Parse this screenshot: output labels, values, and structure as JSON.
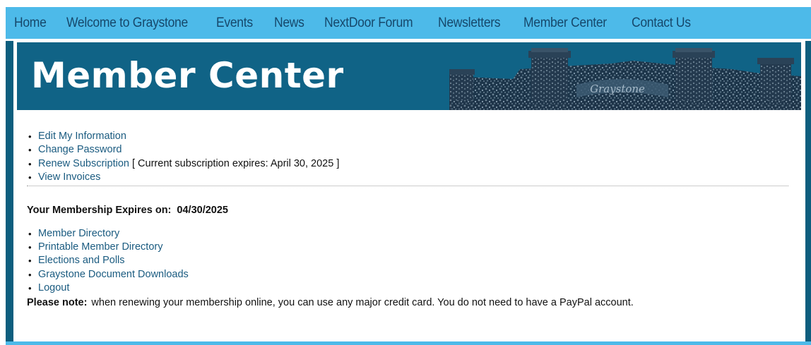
{
  "nav": {
    "items": [
      {
        "label": "Home"
      },
      {
        "label": "Welcome to Graystone"
      },
      {
        "label": "Events"
      },
      {
        "label": "News"
      },
      {
        "label": "NextDoor Forum"
      },
      {
        "label": "Newsletters"
      },
      {
        "label": "Member Center"
      },
      {
        "label": "Contact Us"
      }
    ]
  },
  "banner": {
    "title": "Member Center",
    "image": "graystone-stone-wall-entrance",
    "image_text": "Graystone"
  },
  "account_links": [
    {
      "label": "Edit My Information"
    },
    {
      "label": "Change Password"
    },
    {
      "label": "Renew Subscription",
      "suffix": "[ Current subscription expires: April 30, 2025 ]"
    },
    {
      "label": "View Invoices"
    }
  ],
  "membership": {
    "label": "Your Membership Expires on:",
    "date": "04/30/2025"
  },
  "member_links": [
    {
      "label": "Member Directory"
    },
    {
      "label": "Printable Member Directory"
    },
    {
      "label": "Elections and Polls"
    },
    {
      "label": "Graystone Document Downloads"
    },
    {
      "label": "Logout"
    }
  ],
  "note": {
    "label": "Please note:",
    "text": "when renewing your membership online, you can use any major credit card.  You do not need to have a PayPal account."
  },
  "colors": {
    "nav_bg": "#4dbae9",
    "nav_text": "#16486b",
    "banner_bg": "#106386",
    "frame": "#0d5e7e",
    "link": "#1a5b80"
  }
}
